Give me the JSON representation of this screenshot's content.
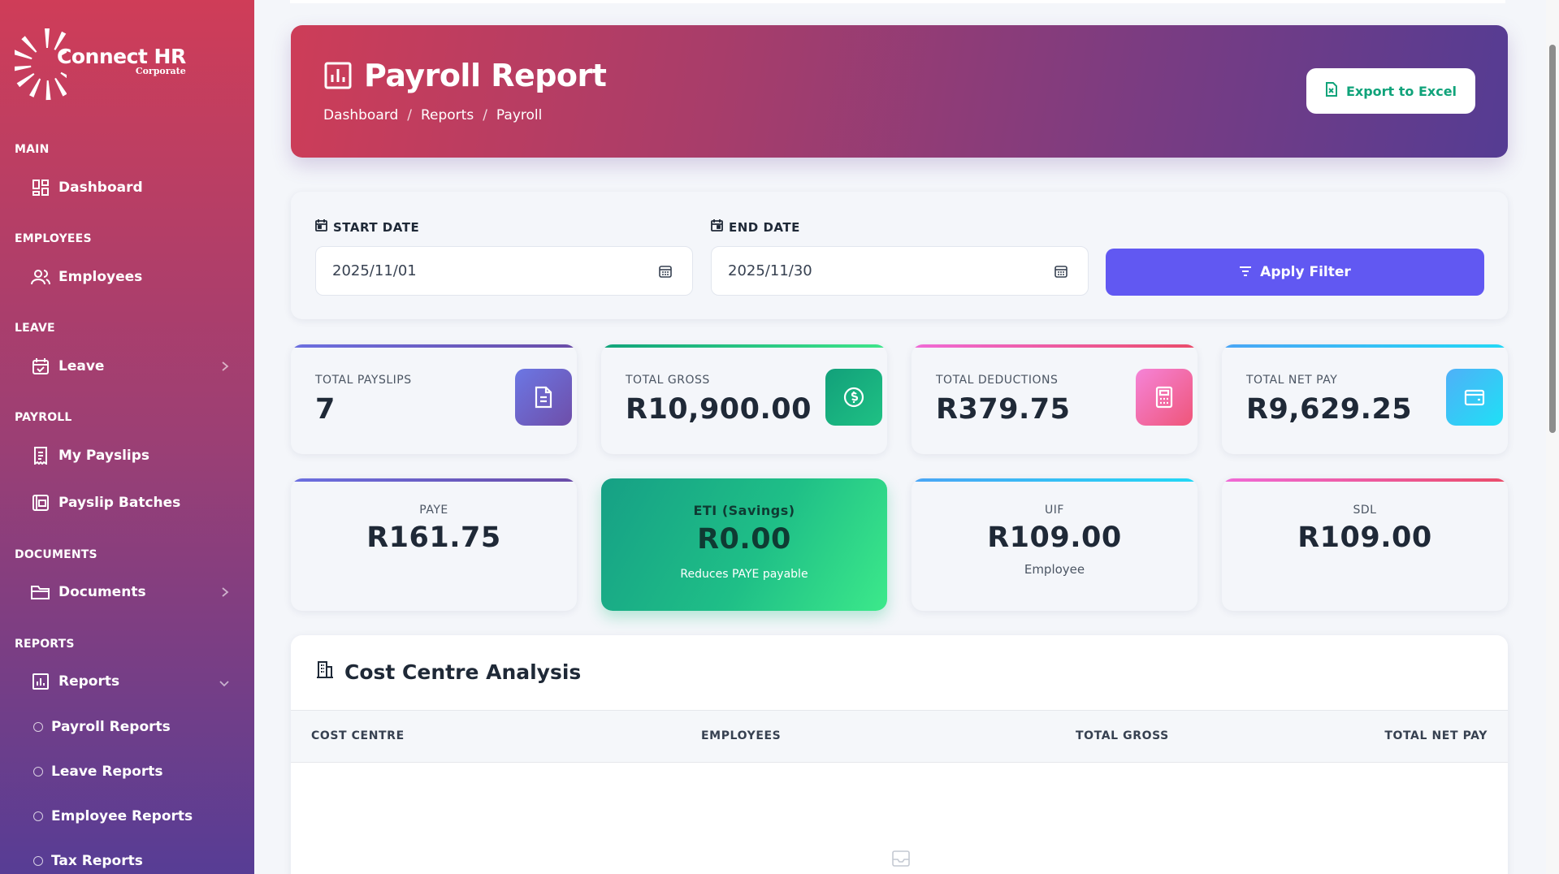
{
  "brand": {
    "name": "Connect HR",
    "sub": "Corporate"
  },
  "sidebar": {
    "sections": [
      {
        "label": "MAIN"
      },
      {
        "label": "EMPLOYEES"
      },
      {
        "label": "LEAVE"
      },
      {
        "label": "PAYROLL"
      },
      {
        "label": "DOCUMENTS"
      },
      {
        "label": "REPORTS"
      }
    ],
    "items": [
      {
        "label": "Dashboard",
        "icon": "dashboard-icon"
      },
      {
        "label": "Employees",
        "icon": "users-icon"
      },
      {
        "label": "Leave",
        "icon": "calendar-check-icon"
      },
      {
        "label": "My Payslips",
        "icon": "receipt-icon"
      },
      {
        "label": "Payslip Batches",
        "icon": "batch-icon"
      },
      {
        "label": "Documents",
        "icon": "folder-icon"
      },
      {
        "label": "Reports",
        "icon": "chart-icon"
      }
    ],
    "report_subitems": [
      {
        "label": "Payroll Reports"
      },
      {
        "label": "Leave Reports"
      },
      {
        "label": "Employee Reports"
      },
      {
        "label": "Tax Reports"
      }
    ]
  },
  "header": {
    "title": "Payroll Report",
    "breadcrumb": [
      "Dashboard",
      "Reports",
      "Payroll"
    ],
    "export_label": "Export to Excel"
  },
  "filter": {
    "start_label": "START DATE",
    "start_value": "2025/11/01",
    "end_label": "END DATE",
    "end_value": "2025/11/30",
    "apply_label": "Apply Filter"
  },
  "stats": [
    {
      "label": "TOTAL PAYSLIPS",
      "value": "7",
      "color": "#6c5fd6"
    },
    {
      "label": "TOTAL GROSS",
      "value": "R10,900.00",
      "color": "#11a37a"
    },
    {
      "label": "TOTAL DEDUCTIONS",
      "value": "R379.75",
      "color": "#ee5a8f"
    },
    {
      "label": "TOTAL NET PAY",
      "value": "R9,629.25",
      "color": "#1cc9f2"
    }
  ],
  "tax": [
    {
      "label": "PAYE",
      "value": "R161.75",
      "sub": ""
    },
    {
      "label": "ETI (Savings)",
      "value": "R0.00",
      "sub": "Reduces PAYE payable"
    },
    {
      "label": "UIF",
      "value": "R109.00",
      "sub": "Employee"
    },
    {
      "label": "SDL",
      "value": "R109.00",
      "sub": ""
    }
  ],
  "cost_centre": {
    "title": "Cost Centre Analysis",
    "columns": [
      "COST CENTRE",
      "EMPLOYEES",
      "TOTAL GROSS",
      "TOTAL NET PAY"
    ]
  }
}
